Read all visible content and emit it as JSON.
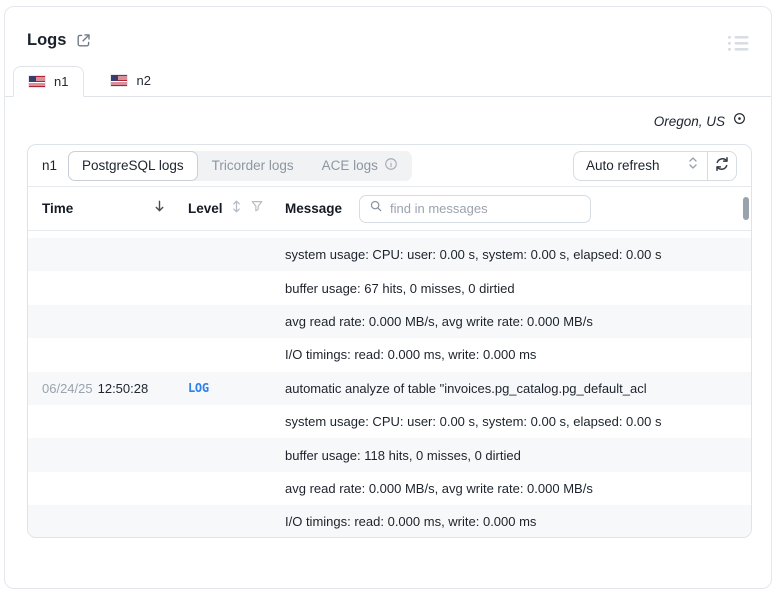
{
  "header": {
    "title": "Logs"
  },
  "tabs": [
    {
      "label": "n1",
      "active": true
    },
    {
      "label": "n2",
      "active": false
    }
  ],
  "region": {
    "label": "Oregon, US"
  },
  "panel": {
    "node_label": "n1",
    "log_type_tabs": [
      {
        "label": "PostgreSQL logs",
        "active": true
      },
      {
        "label": "Tricorder logs",
        "active": false
      },
      {
        "label": "ACE logs",
        "active": false,
        "has_info": true
      }
    ],
    "auto_refresh_label": "Auto refresh",
    "table": {
      "columns": {
        "time": "Time",
        "level": "Level",
        "message": "Message"
      },
      "search_placeholder": "find in messages",
      "rows": [
        {
          "date": "",
          "time": "",
          "level": "",
          "message": "system usage: CPU: user: 0.00 s, system: 0.00 s, elapsed: 0.00 s"
        },
        {
          "date": "",
          "time": "",
          "level": "",
          "message": "buffer usage: 67 hits, 0 misses, 0 dirtied"
        },
        {
          "date": "",
          "time": "",
          "level": "",
          "message": "avg read rate: 0.000 MB/s, avg write rate: 0.000 MB/s"
        },
        {
          "date": "",
          "time": "",
          "level": "",
          "message": "I/O timings: read: 0.000 ms, write: 0.000 ms"
        },
        {
          "date": "06/24/25",
          "time": "12:50:28",
          "level": "LOG",
          "message": "automatic analyze of table \"invoices.pg_catalog.pg_default_acl"
        },
        {
          "date": "",
          "time": "",
          "level": "",
          "message": "system usage: CPU: user: 0.00 s, system: 0.00 s, elapsed: 0.00 s"
        },
        {
          "date": "",
          "time": "",
          "level": "",
          "message": "buffer usage: 118 hits, 0 misses, 0 dirtied"
        },
        {
          "date": "",
          "time": "",
          "level": "",
          "message": "avg read rate: 0.000 MB/s, avg write rate: 0.000 MB/s"
        },
        {
          "date": "",
          "time": "",
          "level": "",
          "message": "I/O timings: read: 0.000 ms, write: 0.000 ms"
        }
      ]
    }
  },
  "icons": {
    "external_link": "open-in-new-window",
    "list": "drag-handle-list",
    "location": "location-target",
    "info": "info-circle",
    "chevron_updown": "select-chevrons",
    "refresh": "circular-arrows",
    "sort_desc": "arrow-down",
    "sort_both": "arrow-up-down",
    "filter": "funnel",
    "search": "magnifier"
  },
  "colors": {
    "accent_blue": "#2f80ed",
    "alt_row_bg": "#f7f8fa",
    "border": "#dee3e9",
    "muted_text": "#9aa3ae"
  }
}
